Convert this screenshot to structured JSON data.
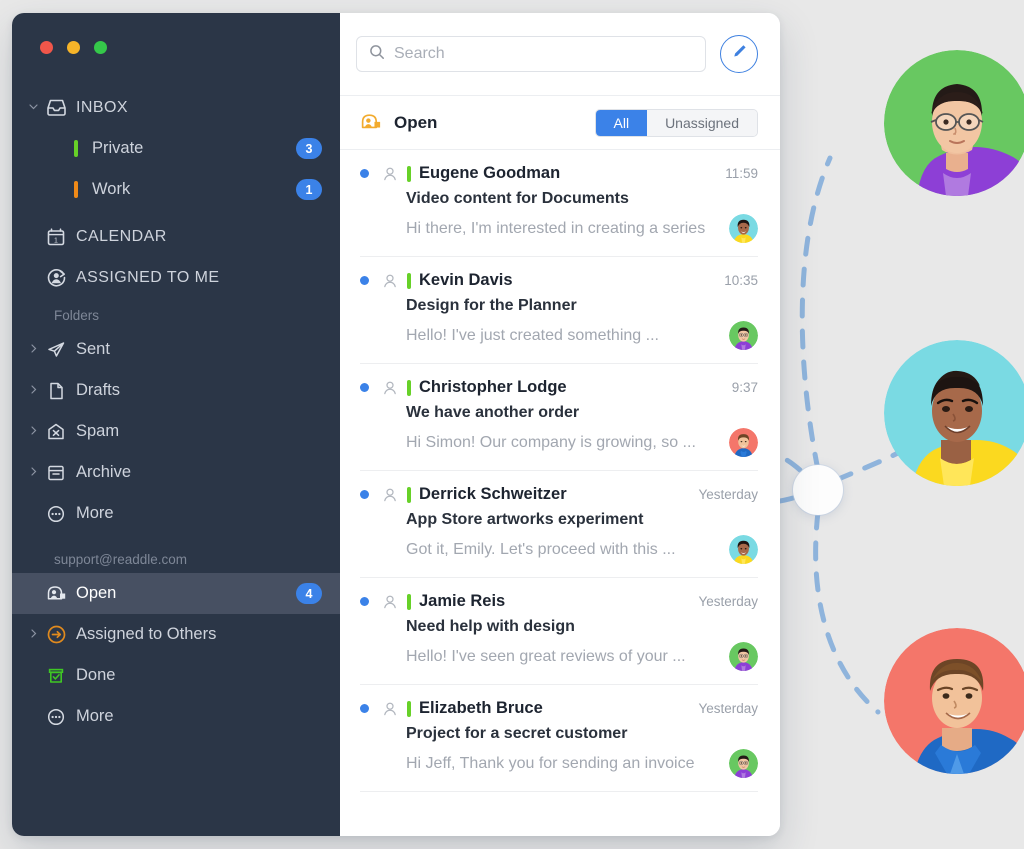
{
  "window": {
    "traffic_lights": [
      "close",
      "minimize",
      "maximize"
    ]
  },
  "sidebar": {
    "inbox": {
      "label": "INBOX",
      "icon": "inbox-icon",
      "expanded": true,
      "children": [
        {
          "label": "Private",
          "tag_color": "#67d128",
          "badge": "3"
        },
        {
          "label": "Work",
          "tag_color": "#f08a18",
          "badge": "1"
        }
      ]
    },
    "top_items": [
      {
        "label": "CALENDAR",
        "icon": "calendar-icon"
      },
      {
        "label": "ASSIGNED TO ME",
        "icon": "assigned-to-me-icon"
      }
    ],
    "folders_header": "Folders",
    "folders": [
      {
        "label": "Sent",
        "icon": "sent-icon",
        "chevron": true
      },
      {
        "label": "Drafts",
        "icon": "drafts-icon",
        "chevron": true
      },
      {
        "label": "Spam",
        "icon": "spam-icon",
        "chevron": true
      },
      {
        "label": "Archive",
        "icon": "archive-icon",
        "chevron": true
      },
      {
        "label": "More",
        "icon": "more-icon",
        "chevron": false
      }
    ],
    "account_header": "support@readdle.com",
    "account_items": [
      {
        "label": "Open",
        "icon": "open-inbox-icon",
        "badge": "4",
        "selected": true,
        "chevron": false
      },
      {
        "label": "Assigned to Others",
        "icon": "assigned-to-others-icon",
        "badge": "",
        "selected": false,
        "chevron": true
      },
      {
        "label": "Done",
        "icon": "done-icon",
        "badge": "",
        "selected": false,
        "chevron": false
      },
      {
        "label": "More",
        "icon": "more-icon",
        "badge": "",
        "selected": false,
        "chevron": false
      }
    ]
  },
  "search": {
    "placeholder": "Search",
    "value": "",
    "icon": "search-icon"
  },
  "compose": {
    "icon": "pencil-icon",
    "label": "Compose"
  },
  "subbar": {
    "title": "Open",
    "icon": "open-inbox-icon",
    "filters": [
      {
        "label": "All",
        "active": true
      },
      {
        "label": "Unassigned",
        "active": false
      }
    ]
  },
  "messages": [
    {
      "sender": "Eugene Goodman",
      "subject": "Video content for Documents",
      "preview": "Hi there, I'm interested in creating a series",
      "time": "11:59",
      "unread": true,
      "tag_color": "#67d128",
      "avatar": "woman-yellow-top"
    },
    {
      "sender": "Kevin Davis",
      "subject": "Design for the Planner",
      "preview": "Hello! I've just created something ...",
      "time": "10:35",
      "unread": true,
      "tag_color": "#67d128",
      "avatar": "man-purple-hoodie"
    },
    {
      "sender": "Christopher Lodge",
      "subject": "We have another order",
      "preview": "Hi Simon! Our company is growing, so ...",
      "time": "9:37",
      "unread": true,
      "tag_color": "#67d128",
      "avatar": "man-blue-shirt"
    },
    {
      "sender": "Derrick Schweitzer",
      "subject": "App Store artworks experiment",
      "preview": "Got it, Emily. Let's proceed with this ...",
      "time": "Yesterday",
      "unread": true,
      "tag_color": "#67d128",
      "avatar": "woman-yellow-top"
    },
    {
      "sender": "Jamie Reis",
      "subject": "Need help with design",
      "preview": "Hello! I've seen great reviews of your ...",
      "time": "Yesterday",
      "unread": true,
      "tag_color": "#67d128",
      "avatar": "man-purple-hoodie"
    },
    {
      "sender": "Elizabeth Bruce",
      "subject": "Project for a secret customer",
      "preview": "Hi Jeff, Thank you for sending an invoice",
      "time": "Yesterday",
      "unread": true,
      "tag_color": "#67d128",
      "avatar": "man-purple-hoodie"
    }
  ],
  "decoration": {
    "people": [
      {
        "name": "person-green-circle",
        "bg": "#68c861"
      },
      {
        "name": "person-cyan-circle",
        "bg": "#7adae3"
      },
      {
        "name": "person-coral-circle",
        "bg": "#f4766a"
      }
    ],
    "connector_color": "#8fb4dc",
    "hub": "network-hub-node"
  },
  "colors": {
    "accent": "#3b82e8",
    "sidebar_bg": "#2b3647",
    "sidebar_selected": "#475062",
    "tag_green": "#67d128",
    "tag_orange": "#f08a18",
    "page_bg": "#e8e8e8"
  }
}
